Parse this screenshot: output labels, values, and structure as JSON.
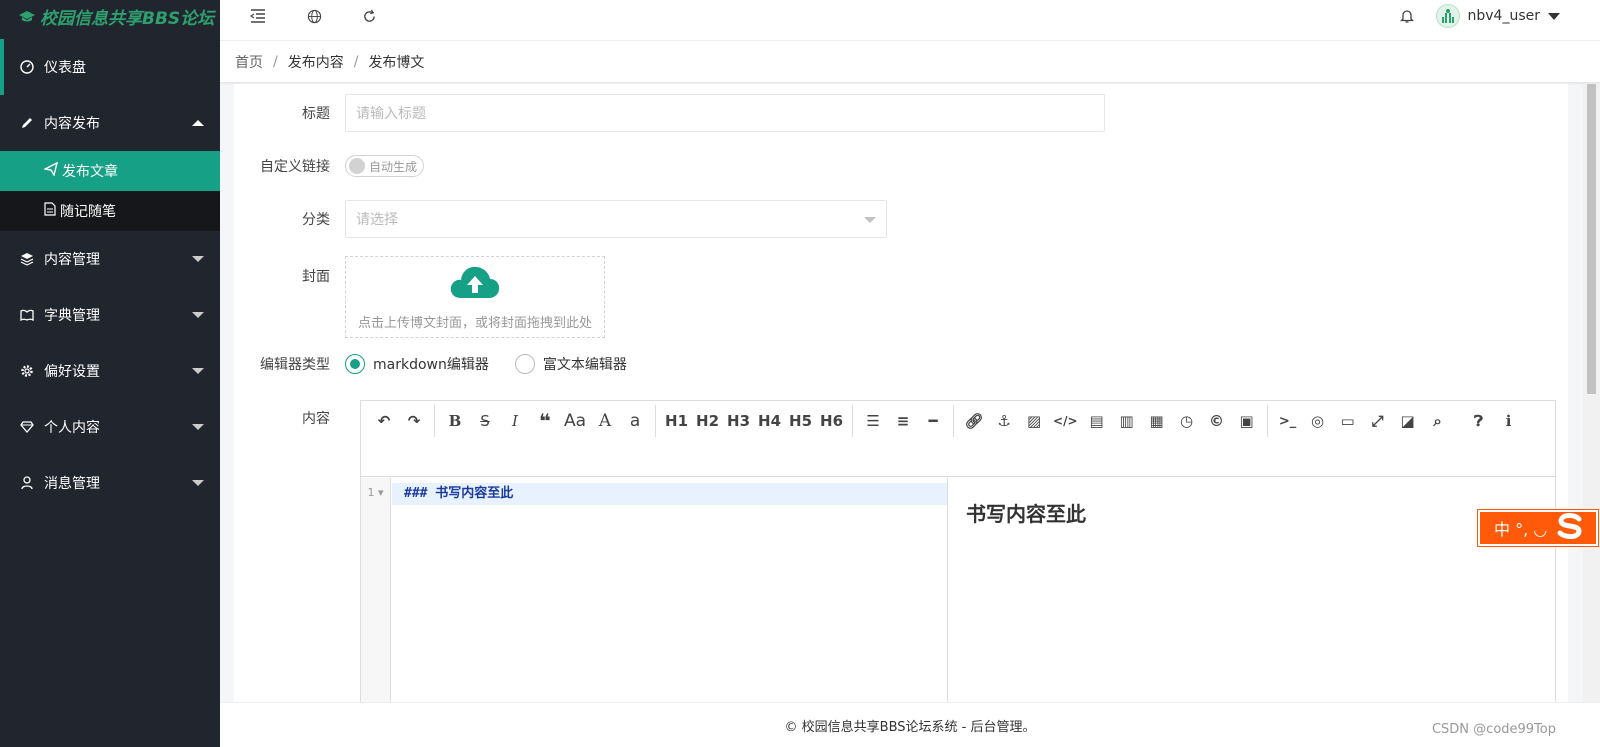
{
  "app": {
    "logo_text": "校园信息共享BBS论坛"
  },
  "sidebar": {
    "items": [
      {
        "label": "仪表盘",
        "icon": "dashboard-icon"
      },
      {
        "label": "内容发布",
        "icon": "pencil-icon"
      },
      {
        "label": "内容管理",
        "icon": "layers-icon"
      },
      {
        "label": "字典管理",
        "icon": "book-icon"
      },
      {
        "label": "偏好设置",
        "icon": "gear-icon"
      },
      {
        "label": "个人内容",
        "icon": "diamond-icon"
      },
      {
        "label": "消息管理",
        "icon": "user-icon"
      }
    ],
    "sub_items": [
      {
        "label": "发布文章",
        "icon": "paper-plane-icon"
      },
      {
        "label": "随记随笔",
        "icon": "document-icon"
      }
    ]
  },
  "topbar": {
    "username": "nbv4_user"
  },
  "breadcrumb": {
    "items": [
      "首页",
      "发布内容",
      "发布博文"
    ],
    "separator": "/"
  },
  "form": {
    "title_label": "标题",
    "title_placeholder": "请输入标题",
    "link_label": "自定义链接",
    "link_switch_text": "自动生成",
    "category_label": "分类",
    "category_placeholder": "请选择",
    "cover_label": "封面",
    "cover_hint": "点击上传博文封面，或将封面拖拽到此处",
    "editor_type_label": "编辑器类型",
    "editor_option_markdown": "markdown编辑器",
    "editor_option_rich": "富文本编辑器",
    "content_label": "内容"
  },
  "editor": {
    "toolbar": [
      "H1",
      "H2",
      "H3",
      "H4",
      "H5",
      "H6"
    ],
    "line_number": "1",
    "code_text": "### 书写内容至此",
    "preview_heading": "书写内容至此"
  },
  "footer": {
    "text": "© 校园信息共享BBS论坛系统 - 后台管理。"
  },
  "watermark": "CSDN @code99Top",
  "ime": {
    "text": "中 °, ◡"
  },
  "colors": {
    "accent": "#16a085",
    "sidebar_bg": "#21252d",
    "ime_bg": "#ff5a0a"
  }
}
